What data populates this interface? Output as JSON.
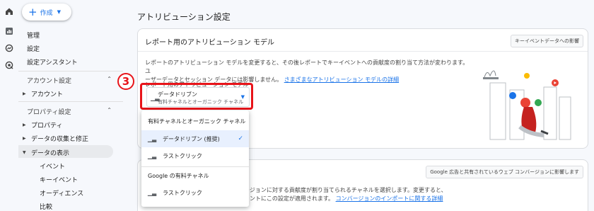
{
  "sidebar": {
    "create_label": "作成",
    "items_top": [
      "管理",
      "設定",
      "設定アシスタント"
    ],
    "account_section": "アカウント設定",
    "account_items": [
      "アカウント"
    ],
    "property_section": "プロパティ設定",
    "property_items": [
      "プロパティ",
      "データの収集と修正",
      "データの表示"
    ],
    "data_display_children": [
      "イベント",
      "キーイベント",
      "オーディエンス",
      "比較"
    ]
  },
  "main": {
    "title": "アトリビューション設定",
    "card1": {
      "title": "レポート用のアトリビューション モデル",
      "chip": "キーイベントデータへの影響",
      "desc_line1": "レポートのアトリビューション モデルを変更すると、その後レポートでキーイベントへの貢献度の割り当て方法が変わります。ユ",
      "desc_line2": "ーザーデータとセッション データには影響しません。",
      "desc_link": "さまざまなアトリビューション モデルの詳細",
      "field_label": "レポート用のアトリビューション モデル",
      "select_value": "データドリブン",
      "select_sub": "有料チャネルとオーガニック チャネル"
    },
    "step_number": "3",
    "dropdown": {
      "group1": "有料チャネルとオーガニック チャネル",
      "g1_options": [
        "データドリブン (推奨)",
        "ラストクリック"
      ],
      "group2": "Google の有料チャネル",
      "g2_options": [
        "ラストクリック"
      ]
    },
    "card2": {
      "chip": "Google 広告と共有されているウェブ コンバージョンに影響します",
      "line1": "ージョンに対する貢献度が割り当てられるチャネルを選択します。変更すると、",
      "line2": "ウントにこの設定が適用されます。",
      "link": "コンバージョンのインポートに関する詳細"
    }
  },
  "colors": {
    "accent": "#1a73e8",
    "annotation": "#e8141a"
  }
}
